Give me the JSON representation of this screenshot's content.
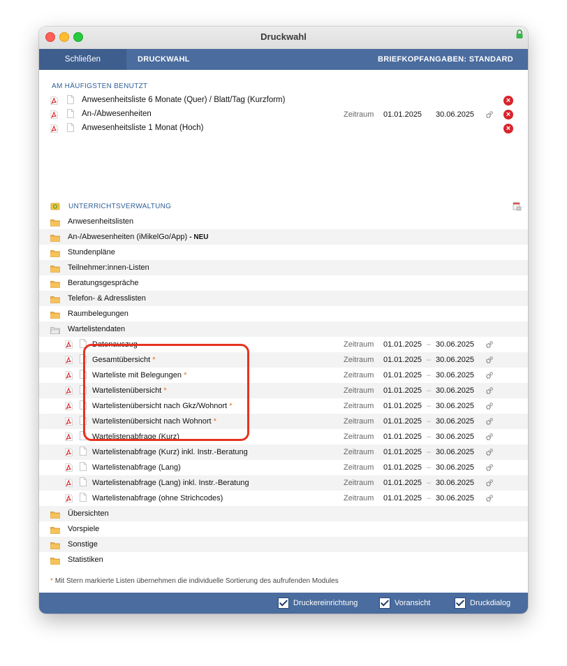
{
  "window": {
    "title": "Druckwahl"
  },
  "toolbar": {
    "close_label": "Schließen",
    "title": "DRUCKWAHL",
    "letterhead": "BRIEFKOPFANGABEN: STANDARD"
  },
  "favorites": {
    "heading": "AM HÄUFIGSTEN BENUTZT",
    "items": [
      {
        "label": "Anwesenheitsliste 6 Monate (Quer) / Blatt/Tag (Kurzform)",
        "zeitraum": "",
        "from": "",
        "to": ""
      },
      {
        "label": "An-/Abwesenheiten",
        "zeitraum": "Zeitraum",
        "from": "01.01.2025",
        "to": "30.06.2025"
      },
      {
        "label": "Anwesenheitsliste 1 Monat (Hoch)",
        "zeitraum": "",
        "from": "",
        "to": ""
      }
    ]
  },
  "unterricht": {
    "heading": "UNTERRICHTSVERWALTUNG",
    "folders_top": [
      {
        "label": "Anwesenheitslisten"
      },
      {
        "label": "An-/Abwesenheiten (iMikelGo/App)",
        "badge": "- NEU"
      },
      {
        "label": "Stundenpläne"
      },
      {
        "label": "Teilnehmer:innen-Listen"
      },
      {
        "label": "Beratungsgespräche"
      },
      {
        "label": "Telefon- & Adresslisten"
      },
      {
        "label": "Raumbelegungen"
      },
      {
        "label": "Wartelistendaten"
      }
    ],
    "reports": [
      {
        "label": "Datenauszug",
        "star": ""
      },
      {
        "label": "Gesamtübersicht",
        "star": "*"
      },
      {
        "label": "Warteliste mit Belegungen",
        "star": "*"
      },
      {
        "label": "Wartelistenübersicht",
        "star": "*"
      },
      {
        "label": "Wartelistenübersicht nach Gkz/Wohnort",
        "star": "*"
      },
      {
        "label": "Wartelistenübersicht nach Wohnort",
        "star": "*"
      },
      {
        "label": "Wartelistenabfrage (Kurz)",
        "star": ""
      },
      {
        "label": "Wartelistenabfrage (Kurz) inkl. Instr.-Beratung",
        "star": ""
      },
      {
        "label": "Wartelistenabfrage (Lang)",
        "star": ""
      },
      {
        "label": "Wartelistenabfrage (Lang) inkl. Instr.-Beratung",
        "star": ""
      },
      {
        "label": "Wartelistenabfrage (ohne Strichcodes)",
        "star": ""
      }
    ],
    "report_zeitraum": "Zeitraum",
    "report_from": "01.01.2025",
    "report_to": "30.06.2025",
    "folders_bottom": [
      {
        "label": "Übersichten"
      },
      {
        "label": "Vorspiele"
      },
      {
        "label": "Sonstige"
      },
      {
        "label": "Statistiken"
      }
    ]
  },
  "footnote": {
    "star": "*",
    "text": "Mit Stern markierte Listen übernehmen die individuelle Sortierung des aufrufenden Modules"
  },
  "options": {
    "printer_setup": "Druckereinrichtung",
    "preview": "Voransicht",
    "print_dialog": "Druckdialog"
  }
}
